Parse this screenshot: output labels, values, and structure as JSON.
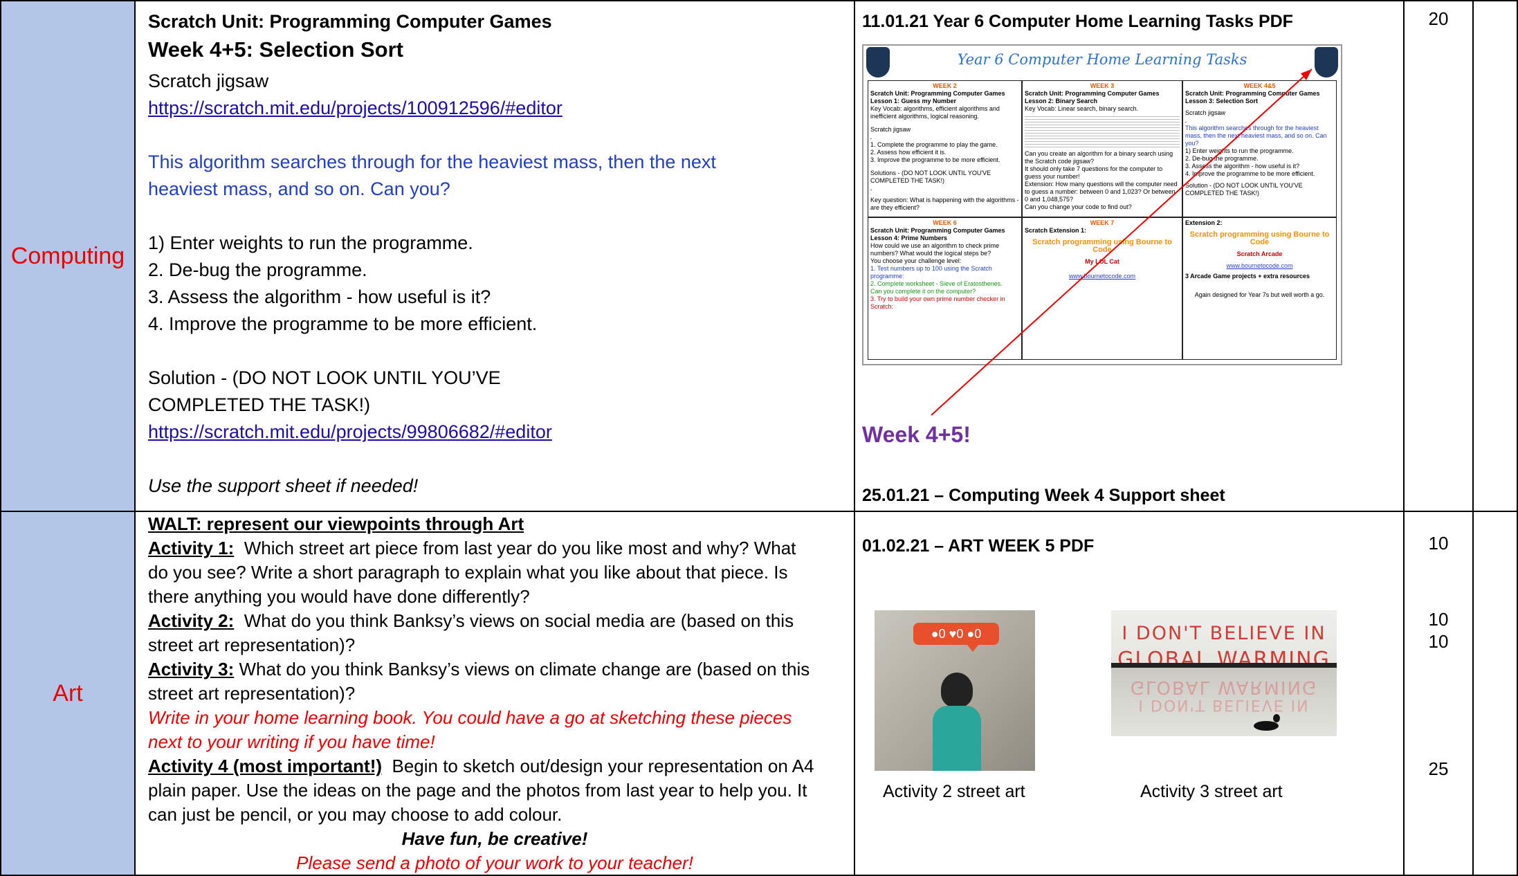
{
  "computing": {
    "subject": "Computing",
    "unit_title": "Scratch Unit: Programming Computer Games",
    "week_title": "Week 4+5: Selection Sort",
    "jigsaw_label": "Scratch jigsaw",
    "jigsaw_link": "https://scratch.mit.edu/projects/100912596/#editor",
    "intro_line1": "This algorithm searches through for the heaviest mass, then the next",
    "intro_line2": "heaviest mass, and so on. Can you?",
    "step1": "1) Enter weights to run the programme.",
    "step2": "2. De-bug the programme.",
    "step3": "3. Assess the algorithm - how useful is it?",
    "step4": "4. Improve the programme to be more efficient.",
    "solution_line1": "Solution - (DO NOT LOOK UNTIL YOU’VE",
    "solution_line2": "COMPLETED THE TASK!)",
    "solution_link": "https://scratch.mit.edu/projects/99806682/#editor",
    "support_note": "Use the support sheet if needed!",
    "resource_title": "11.01.21 Year 6 Computer Home Learning Tasks PDF",
    "week_callout": "Week 4+5!",
    "support_sheet": "25.01.21 – Computing Week 4 Support sheet",
    "minutes": "20",
    "thumbnail": {
      "title": "Year 6 Computer Home Learning Tasks",
      "week2_head": "WEEK 2",
      "week2_l1": "Scratch Unit: Programming Computer Games",
      "week2_l2": "Lesson 1: Guess my Number",
      "week2_l3": "Key Vocab: algorithms, efficient algorithms and inefficient algorithms, logical reasoning.",
      "week2_l4": "Scratch jigsaw",
      "week2_l5": "1. Complete the programme to play the game.",
      "week2_l6": "2. Assess how efficient it is.",
      "week2_l7": "3. Improve the programme to be more efficient.",
      "week2_l8": "Solutions - (DO NOT LOOK UNTIL YOU'VE COMPLETED THE TASK!)",
      "week2_l9": "Key question: What is happening with the algorithms - are they efficient?",
      "week3_head": "WEEK 3",
      "week3_l1": "Scratch Unit: Programming Computer Games",
      "week3_l2": "Lesson 2: Binary Search",
      "week3_l3": "Key Vocab: Linear search, binary search.",
      "week3_l4": "Can you create an algorithm for a binary search using the Scratch code jigsaw?",
      "week3_l5": "It should only take 7 questions for the computer to guess your number!",
      "week3_l6": "Extension: How many questions will the computer need to guess a number: between 0 and 1,023? Or between 0 and 1,048,575?",
      "week3_l7": "Can you change your code to find out?",
      "week45_head": "WEEK 4&5",
      "week45_l1": "Scratch Unit: Programming Computer Games",
      "week45_l2": "Lesson 3: Selection Sort",
      "week45_l3": "Scratch jigsaw",
      "week45_l4": "This algorithm searches through for the heaviest mass, then the next heaviest mass, and so on. Can you?",
      "week45_l5": "1) Enter weights to run the programme.",
      "week45_l6": "2. De-bug the programme.",
      "week45_l7": "3. Assess the algorithm - how useful is it?",
      "week45_l8": "4. Improve the programme to be more efficient.",
      "week45_l9": "Solution - (DO NOT LOOK UNTIL YOU'VE COMPLETED THE TASK!)",
      "week6_head": "WEEK 6",
      "week6_l1": "Scratch Unit: Programming Computer Games",
      "week6_l2": "Lesson 4: Prime Numbers",
      "week6_l3": "How could we use an algorithm to check prime numbers? What would the logical steps be?",
      "week6_l4": "You choose your challenge level:",
      "week6_l5": "1. Test numbers up to 100 using the Scratch programme:",
      "week6_l6": "2. Complete worksheet - Sieve of Eratosthenes.",
      "week6_l7": "Can you complete it on the computer?",
      "week6_l8": "3. Try to build your own prime number checker in Scratch:",
      "week7_head": "WEEK 7",
      "week7_l1": "Scratch Extension 1:",
      "week7_l2": "Scratch programming using Bourne to Code",
      "week7_l3": "My LOL Cat",
      "week7_l4": "www.bournetocode.com",
      "ext2_l1": "Extension 2:",
      "ext2_l2": "Scratch programming using Bourne to Code",
      "ext2_l3": "Scratch Arcade",
      "ext2_l4": "www.bournetocode.com",
      "ext2_l5": "3 Arcade Game projects + extra resources",
      "ext2_l6": "Again designed for Year 7s but well worth a go."
    }
  },
  "art": {
    "subject": "Art",
    "walt": "WALT: represent our viewpoints through Art",
    "a1_label": "Activity 1:",
    "a1_text": "  Which street art piece from last year do you like most and why? What",
    "a1_line2": "do you see? Write a short paragraph to explain what you like about that piece. Is",
    "a1_line3": "there anything you would have done differently?",
    "a2_label": "Activity 2:",
    "a2_text": "  What do you think Banksy’s views on social media are (based on this",
    "a2_line2": "street art representation)?",
    "a3_label": "Activity 3:",
    "a3_text": " What do you think Banksy’s views on climate change are (based on this",
    "a3_line2": "street art representation)?",
    "book_line1": "Write in your home learning book. You could have a go at sketching these pieces",
    "book_line2": "next to your writing if you have time!",
    "a4_label": "Activity 4 (most important!)",
    "a4_text": "  Begin to sketch out/design your representation on A4",
    "a4_line2": "plain paper. Use the ideas on the page and the photos from last year to help you. It",
    "a4_line3": "can just be pencil, or you may choose to add colour.",
    "fun": "Have fun, be creative!",
    "send": "Please send a photo of your work to your teacher!",
    "resource_title": "01.02.21 – ART WEEK 5 PDF",
    "caption2": "Activity 2 street art",
    "caption3": "Activity 3 street art",
    "mural_text_line1": "I DON'T BELIEVE IN",
    "mural_text_line2": "GLOBAL WARMING",
    "minutes": [
      "10",
      "10",
      "10",
      "25"
    ]
  }
}
